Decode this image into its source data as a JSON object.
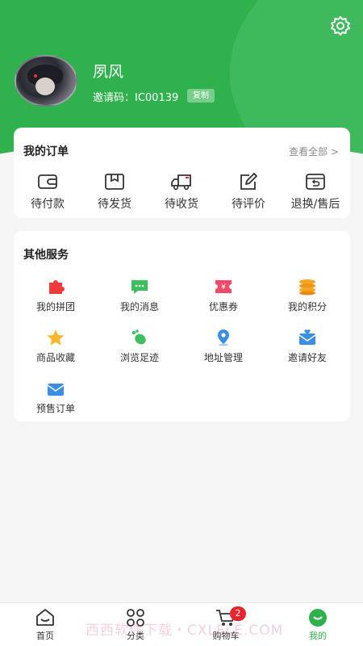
{
  "profile": {
    "name": "夙风",
    "invite_label": "邀请码：IC00139",
    "copy_label": "复制"
  },
  "orders": {
    "title": "我的订单",
    "view_all": "查看全部 >",
    "items": [
      {
        "label": "待付款",
        "icon": "wallet-icon"
      },
      {
        "label": "待发货",
        "icon": "box-icon"
      },
      {
        "label": "待收货",
        "icon": "truck-icon"
      },
      {
        "label": "待评价",
        "icon": "edit-icon"
      },
      {
        "label": "退换/售后",
        "icon": "return-icon"
      }
    ]
  },
  "services": {
    "title": "其他服务",
    "items": [
      {
        "label": "我的拼团",
        "icon": "puzzle-icon"
      },
      {
        "label": "我的消息",
        "icon": "message-icon"
      },
      {
        "label": "优惠券",
        "icon": "coupon-icon"
      },
      {
        "label": "我的积分",
        "icon": "coins-icon"
      },
      {
        "label": "商品收藏",
        "icon": "star-icon"
      },
      {
        "label": "浏览足迹",
        "icon": "footprint-icon"
      },
      {
        "label": "地址管理",
        "icon": "location-icon"
      },
      {
        "label": "邀请好友",
        "icon": "invite-mail-icon"
      },
      {
        "label": "预售订单",
        "icon": "presale-mail-icon"
      }
    ]
  },
  "tabbar": {
    "items": [
      {
        "label": "首页",
        "icon": "home-icon"
      },
      {
        "label": "分类",
        "icon": "category-icon"
      },
      {
        "label": "购物车",
        "icon": "cart-icon",
        "badge": "2"
      },
      {
        "label": "我的",
        "icon": "profile-icon",
        "active": true
      }
    ]
  },
  "watermark": "西西软件下载・CXLELE.COM",
  "colors": {
    "brand": "#2fb24d",
    "badge": "#e8242c"
  }
}
